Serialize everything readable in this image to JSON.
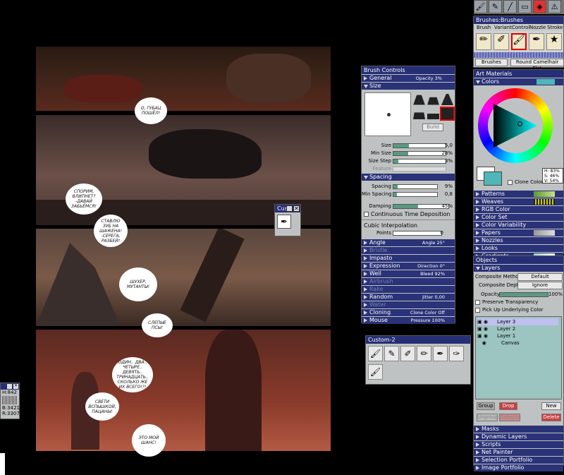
{
  "artwork": {
    "bubbles": [
      "О, ГУБАЦ ПОШЁЛ!",
      "СПОРИМ, ВЛИПНЕТ? -ДАВАЙ ЗАБЬЁМСЯ!",
      "СТАВЛЮ ЗУБ НА ШАЖЕНА! -СЕРЕГА, РАЗБЕЙ!",
      "ШУХЕР, МУТАНТЫ!",
      "СЛЕПЫЕ ПСЫ!",
      "ОДИН.. ДВА.. ЧЕТЫРЕ.. ДЕВЯТЬ.. ТРИНАДЦАТЬ.. СКОЛЬКО ЖЕ ИХ ВСЕГО!?!",
      "СВЕТИ ВСПЫШКОЙ, ПАЦАНЫ!",
      "ЭТО МОЙ ШАНС!"
    ]
  },
  "toolbar": {
    "tools": [
      "brush",
      "dropper",
      "pen",
      "rect",
      "paint-bucket",
      "warning"
    ]
  },
  "brushes": {
    "title": "Brushes:Brushes",
    "menu": [
      "Brush",
      "Variant",
      "Control",
      "Nozzle",
      "Stroke"
    ],
    "category": "Brushes",
    "variant": "Round Camelhair Flat"
  },
  "brush_controls": {
    "title": "Brush Controls",
    "general": {
      "label": "General",
      "value": "Opacity 3%"
    },
    "size_label": "Size",
    "build_label": "Build",
    "size_rows": [
      {
        "label": "Size",
        "value": "5,0",
        "pct": 0.3
      },
      {
        "label": "Min Size",
        "value": "28%",
        "pct": 0.28
      },
      {
        "label": "Size Step",
        "value": "3%",
        "pct": 0.1
      }
    ],
    "feature_label": "Feature",
    "spacing_label": "Spacing",
    "spacing_rows": [
      {
        "label": "Spacing",
        "value": "9%",
        "pct": 0.09
      },
      {
        "label": "Min Spacing",
        "value": "0,8",
        "pct": 0.08
      }
    ],
    "damping": {
      "label": "Damping",
      "value": "45%",
      "pct": 0.45
    },
    "continuous": "Continuous Time Deposition",
    "cubic": "Cubic Interpolation",
    "points": {
      "label": "Points",
      "value": "0"
    },
    "sections": [
      {
        "label": "Angle",
        "value": "Angle 25°",
        "dim": false
      },
      {
        "label": "Bristle",
        "value": "",
        "dim": true
      },
      {
        "label": "Impasto",
        "value": "",
        "dim": false
      },
      {
        "label": "Expression",
        "value": "Direction 0°",
        "dim": false
      },
      {
        "label": "Well",
        "value": "Bleed 92%",
        "dim": false
      },
      {
        "label": "Airbrush",
        "value": "",
        "dim": true
      },
      {
        "label": "Rake",
        "value": "",
        "dim": true
      },
      {
        "label": "Random",
        "value": "Jitter 0,00",
        "dim": false
      },
      {
        "label": "Water",
        "value": "",
        "dim": true
      },
      {
        "label": "Cloning",
        "value": "Clone Color Off",
        "dim": false
      },
      {
        "label": "Mouse",
        "value": "Pressure 100%",
        "dim": false
      }
    ]
  },
  "custom1": {
    "title": "Cus"
  },
  "custom2": {
    "title": "Custom-2"
  },
  "art_materials": {
    "title": "Art Materials",
    "colors_label": "Colors",
    "clone_color": "Clone Color",
    "hsv": {
      "h": "H: 83%",
      "s": "S: 46%",
      "v": "V: 54%"
    },
    "main_color": "#4fb7b7",
    "sections": [
      "Patterns",
      "Weaves",
      "RGB Color",
      "Color Set",
      "Color Variability",
      "Papers",
      "Nozzles",
      "Looks",
      "Gradients"
    ]
  },
  "objects": {
    "title": "Objects",
    "layers_label": "Layers",
    "composite_method_label": "Composite Method",
    "composite_method": "Default",
    "composite_depth_label": "Composite Depth",
    "composite_depth": "Ignore",
    "opacity_label": "Opacity",
    "opacity_value": "100%",
    "preserve": "Preserve Transparency",
    "pickup": "Pick Up Underlying Color",
    "layers": [
      "Layer 3",
      "Layer 2",
      "Layer 1",
      "Canvas"
    ],
    "buttons": {
      "group": "Group",
      "drop": "Drop",
      "new": "New",
      "ungroup": "Ungroup",
      "collapse": "Collapse",
      "delete": "Delete"
    },
    "sections": [
      "Masks",
      "Dynamic Layers",
      "Scripts",
      "Net Painter",
      "Selection Portfolio",
      "Image Portfolio"
    ]
  },
  "info": {
    "h": "H:842",
    "b": "B:3421",
    "r": "R:3307"
  }
}
